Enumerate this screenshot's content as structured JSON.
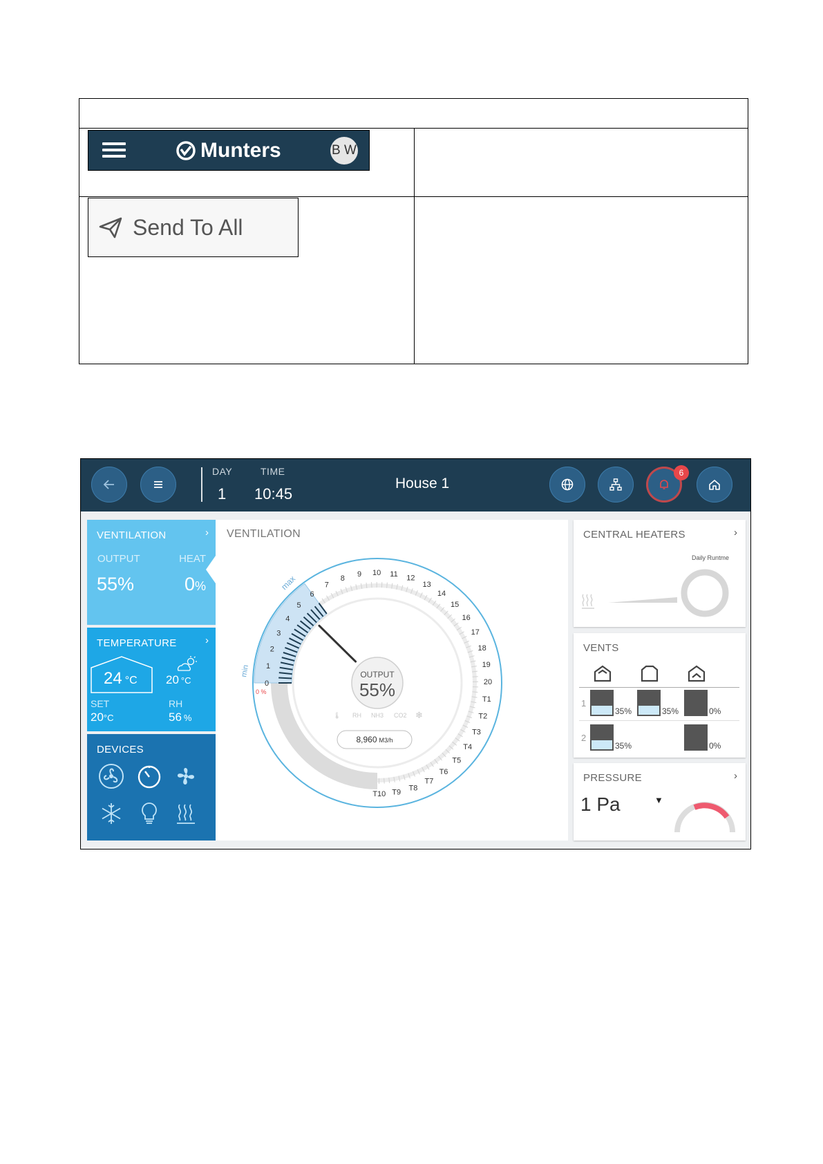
{
  "top_bar": {
    "brand": "Munters",
    "user_initials": "B W"
  },
  "send_button": {
    "label": "Send To All"
  },
  "screen": {
    "day_label": "DAY",
    "day_value": "1",
    "time_label": "TIME",
    "time_value": "10:45",
    "house": "House 1",
    "alarm_count": "6"
  },
  "sidebar": {
    "ventilation": {
      "title": "VENTILATION",
      "output_label": "OUTPUT",
      "output_value": "55%",
      "heat_label": "HEAT",
      "heat_value": "0",
      "heat_unit": "%"
    },
    "temperature": {
      "title": "TEMPERATURE",
      "current_value": "24",
      "current_unit": "°C",
      "outside_value": "20",
      "outside_unit": "°C",
      "set_label": "SET",
      "set_value": "20",
      "set_unit": "°C",
      "rh_label": "RH",
      "rh_value": "56",
      "rh_unit": "%"
    },
    "devices": {
      "title": "DEVICES"
    }
  },
  "ventilation_panel": {
    "title": "VENTILATION",
    "output_label": "OUTPUT",
    "output_value": "55%",
    "airflow": "8,960",
    "airflow_unit": "M3/h",
    "min_label": "min",
    "max_label": "max",
    "zero_pct": "0 %",
    "stage_labels": [
      "0",
      "1",
      "2",
      "3",
      "4",
      "5",
      "6",
      "7",
      "8",
      "9",
      "10",
      "11",
      "12",
      "13",
      "14",
      "15",
      "16",
      "17",
      "18",
      "19",
      "20"
    ],
    "tunnel_labels": [
      "T1",
      "T2",
      "T3",
      "T4",
      "T5",
      "T6",
      "T7",
      "T8",
      "T9",
      "T10"
    ],
    "sensor_labels": [
      "RH",
      "NH3",
      "CO2"
    ]
  },
  "central_heaters": {
    "title": "CENTRAL HEATERS",
    "runtime_label": "Daily Runtme"
  },
  "vents": {
    "title": "VENTS",
    "rows": [
      {
        "index": "1",
        "values": [
          "35%",
          "35%",
          "0%"
        ],
        "levels": [
          0.35,
          0.35,
          0
        ]
      },
      {
        "index": "2",
        "values": [
          "35%",
          "",
          "0%"
        ],
        "levels": [
          0.35,
          null,
          0
        ]
      }
    ]
  },
  "pressure": {
    "title": "PRESSURE",
    "value": "1 Pa"
  },
  "colors": {
    "dark_navy": "#1e3d52",
    "light_blue": "#63c4ef",
    "mid_blue": "#1ea7e6",
    "deep_blue": "#1b73b0",
    "alarm_red": "#e8474a"
  }
}
